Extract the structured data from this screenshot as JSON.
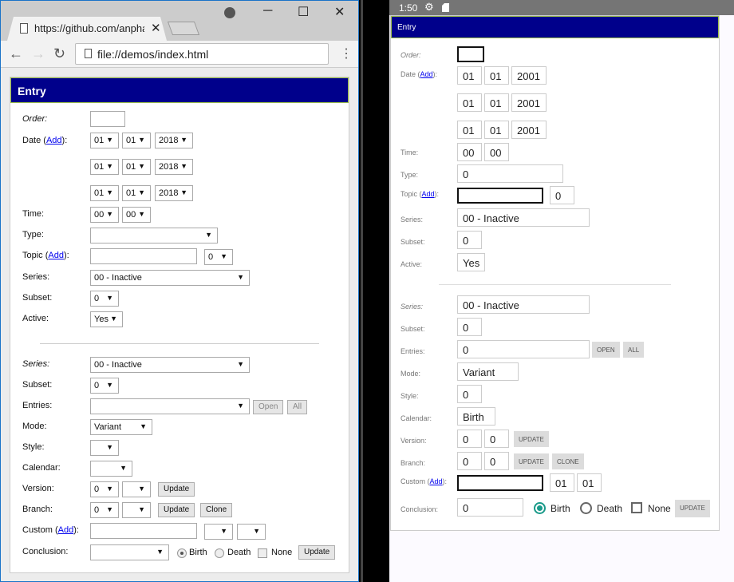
{
  "browser": {
    "tab_title": "https://github.com/anpha",
    "url": "file://demos/index.html"
  },
  "form": {
    "title": "Entry",
    "labels": {
      "order": "Order:",
      "date_prefix": "Date (",
      "add": "Add",
      "date_suffix": "):",
      "time": "Time:",
      "type": "Type:",
      "topic_prefix": "Topic (",
      "series": "Series:",
      "subset": "Subset:",
      "active": "Active:",
      "series2": "Series:",
      "subset2": "Subset:",
      "entries": "Entries:",
      "mode": "Mode:",
      "style": "Style:",
      "calendar": "Calendar:",
      "version": "Version:",
      "branch": "Branch:",
      "custom_prefix": "Custom (",
      "conclusion": "Conclusion:"
    },
    "buttons": {
      "open": "Open",
      "all": "All",
      "update": "Update",
      "clone": "Clone"
    },
    "radios": {
      "birth": "Birth",
      "death": "Death",
      "none": "None"
    }
  },
  "desktop": {
    "order": "",
    "dates": [
      {
        "day": "01",
        "month": "01",
        "year": "2018"
      },
      {
        "day": "01",
        "month": "01",
        "year": "2018"
      },
      {
        "day": "01",
        "month": "01",
        "year": "2018"
      }
    ],
    "time": {
      "hour": "00",
      "minute": "00"
    },
    "type": "",
    "topic": "",
    "topic_num": "0",
    "series": "00 - Inactive",
    "subset": "0",
    "active": "Yes",
    "series2": "00 - Inactive",
    "subset2": "0",
    "entries": "",
    "mode": "Variant",
    "style": "",
    "calendar": "",
    "version": {
      "a": "0",
      "b": ""
    },
    "branch": {
      "a": "0",
      "b": ""
    },
    "custom": {
      "text": "",
      "a": "",
      "b": ""
    },
    "conclusion": "",
    "conclusion_choice": "Birth"
  },
  "android": {
    "status_time": "1:50",
    "dates": [
      {
        "day": "01",
        "month": "01",
        "year": "2001"
      },
      {
        "day": "01",
        "month": "01",
        "year": "2001"
      },
      {
        "day": "01",
        "month": "01",
        "year": "2001"
      }
    ],
    "time": {
      "hour": "00",
      "minute": "00"
    },
    "type": "0",
    "topic": "",
    "topic_num": "0",
    "series": "00 - Inactive",
    "subset": "0",
    "active": "Yes",
    "series2": "00 - Inactive",
    "subset2": "0",
    "entries": "0",
    "mode": "Variant",
    "style": "0",
    "calendar": "Birth",
    "version": {
      "a": "0",
      "b": "0"
    },
    "branch": {
      "a": "0",
      "b": "0"
    },
    "custom": {
      "text": "",
      "a": "01",
      "b": "01"
    },
    "conclusion": "0",
    "buttons": {
      "open": "OPEN",
      "all": "ALL",
      "update": "UPDATE",
      "clone": "CLONE"
    }
  }
}
